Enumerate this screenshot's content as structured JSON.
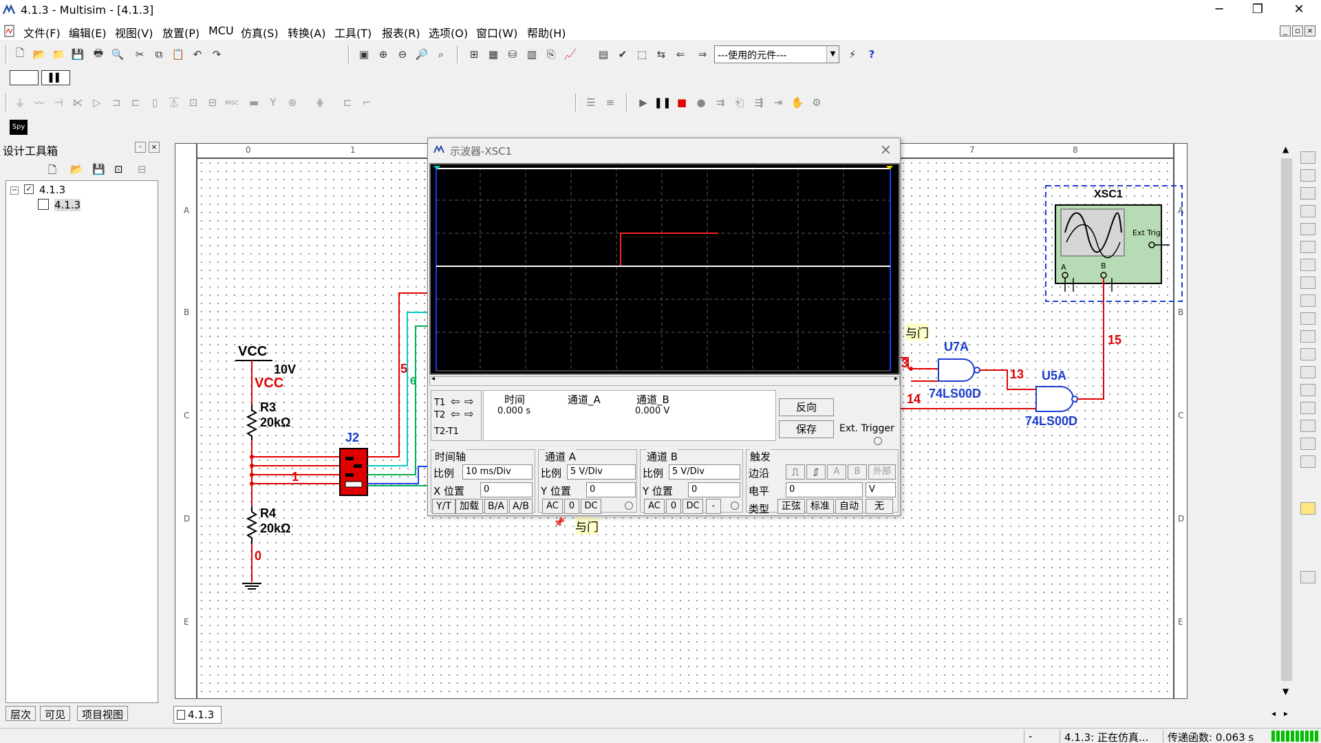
{
  "window": {
    "title": "4.1.3 - Multisim - [4.1.3]",
    "minimize": "─",
    "restore": "❐",
    "close": "✕"
  },
  "menu": [
    "文件(F)",
    "编辑(E)",
    "视图(V)",
    "放置(P)",
    "MCU",
    "仿真(S)",
    "转换(A)",
    "工具(T)",
    "报表(R)",
    "选项(O)",
    "窗口(W)",
    "帮助(H)"
  ],
  "toolbar": {
    "components_combo": "---使用的元件---",
    "spy_label": "Spy"
  },
  "design_toolbox": {
    "title": "设计工具箱",
    "root": "4.1.3",
    "child": "4.1.3",
    "tabs": [
      "层次",
      "可见",
      "项目视图"
    ]
  },
  "sheet_tab": "4.1.3",
  "ruler": {
    "cols": [
      "0",
      "1",
      "7",
      "8"
    ],
    "rows": [
      "A",
      "B",
      "C",
      "D",
      "E"
    ]
  },
  "schematic": {
    "vcc": "VCC",
    "vcc_value": "10V",
    "vcc_name": "VCC",
    "r3_name": "R3",
    "r3_value": "20kΩ",
    "r4_name": "R4",
    "r4_value": "20kΩ",
    "j2": "J2",
    "xsc1": "XSC1",
    "ext_trig": "Ext Trig",
    "scope_a": "A",
    "scope_b": "B",
    "u7a": "U7A",
    "u7a_part": "74LS00D",
    "u5a": "U5A",
    "u5a_part": "74LS00D",
    "and_gate_1": "与门",
    "and_gate_2": "与门",
    "nets": {
      "n0": "0",
      "n1": "1",
      "n3": "3",
      "n5": "5",
      "n6": "6",
      "n13": "13",
      "n14": "14",
      "n15": "15"
    }
  },
  "scope": {
    "title": "示波器-XSC1",
    "cursor_t1": "T1",
    "cursor_t2": "T2",
    "t2_t1": "T2-T1",
    "col_time": "时间",
    "col_cha": "通道_A",
    "col_chb": "通道_B",
    "t1_time": "0.000 s",
    "t1_chb": "0.000 V",
    "reverse": "反向",
    "save": "保存",
    "ext_trigger": "Ext. Trigger",
    "timebase": {
      "title": "时间轴",
      "scale_label": "比例",
      "scale": "10 ms/Div",
      "xpos_label": "X 位置",
      "xpos": "0",
      "yt": "Y/T",
      "add": "加载",
      "ba": "B/A",
      "ab": "A/B"
    },
    "cha": {
      "title": "通道 A",
      "scale_label": "比例",
      "scale": "5  V/Div",
      "ypos_label": "Y 位置",
      "ypos": "0",
      "ac": "AC",
      "zero": "0",
      "dc": "DC"
    },
    "chb": {
      "title": "通道 B",
      "scale_label": "比例",
      "scale": "5  V/Div",
      "ypos_label": "Y 位置",
      "ypos": "0",
      "ac": "AC",
      "zero": "0",
      "dc": "DC",
      "minus": "-"
    },
    "trigger": {
      "title": "触发",
      "edge_label": "边沿",
      "a": "A",
      "b": "B",
      "ext": "外部",
      "level_label": "电平",
      "level": "0",
      "unit": "V",
      "type_label": "类型",
      "sine": "正弦",
      "normal": "标准",
      "auto": "自动",
      "none": "无"
    }
  },
  "status": {
    "sep": "-",
    "sim": "4.1.3: 正在仿真...",
    "transfer": "传递函数: 0.063 s"
  },
  "colors": {
    "wire_red": "#e00000",
    "wire_green": "#00b050",
    "wire_blue": "#1a3cff",
    "wire_cyan": "#00c8c8",
    "label_blue": "#1a3cd0",
    "net_red": "#e00000",
    "trace_red": "#ff2020",
    "trace_white": "#ffffff"
  }
}
